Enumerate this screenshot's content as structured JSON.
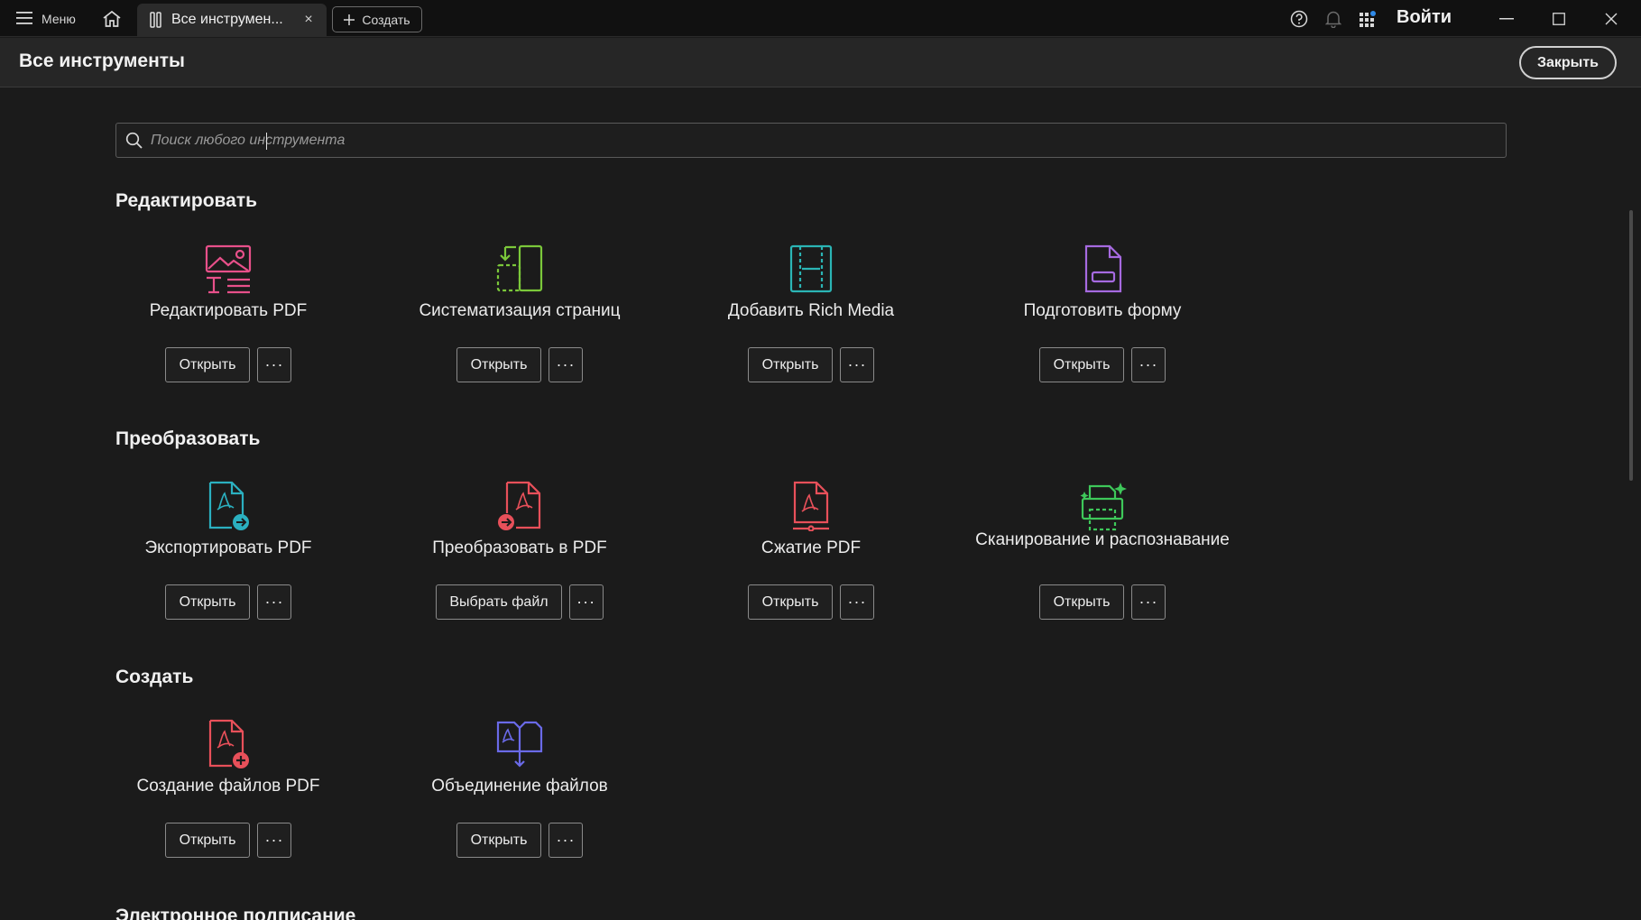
{
  "titlebar": {
    "menu_label": "Меню",
    "tab_label": "Все инструмен...",
    "tab_close": "×",
    "create_label": "Создать",
    "login_label": "Войти"
  },
  "header": {
    "title": "Все инструменты",
    "close_label": "Закрыть"
  },
  "search": {
    "placeholder": "Поиск любого инструмента"
  },
  "sections": [
    {
      "title": "Редактировать",
      "tools": [
        {
          "name": "Редактировать PDF",
          "button": "Открыть",
          "icon": "edit-pdf-icon",
          "color": "#e8508a"
        },
        {
          "name": "Систематизация страниц",
          "button": "Открыть",
          "icon": "organize-pages-icon",
          "color": "#7bc83a"
        },
        {
          "name": "Добавить Rich Media",
          "button": "Открыть",
          "icon": "rich-media-icon",
          "color": "#2bb5b5"
        },
        {
          "name": "Подготовить форму",
          "button": "Открыть",
          "icon": "prepare-form-icon",
          "color": "#a66ae0"
        }
      ]
    },
    {
      "title": "Преобразовать",
      "tools": [
        {
          "name": "Экспортировать PDF",
          "button": "Открыть",
          "icon": "export-pdf-icon",
          "color": "#2bb0c0"
        },
        {
          "name": "Преобразовать в PDF",
          "button": "Выбрать файл",
          "icon": "convert-to-pdf-icon",
          "color": "#e8505a"
        },
        {
          "name": "Сжатие PDF",
          "button": "Открыть",
          "icon": "compress-pdf-icon",
          "color": "#e8505a"
        },
        {
          "name": "Сканирование и распознавание",
          "button": "Открыть",
          "icon": "scan-ocr-icon",
          "color": "#3ec85a"
        }
      ]
    },
    {
      "title": "Создать",
      "tools": [
        {
          "name": "Создание файлов PDF",
          "button": "Открыть",
          "icon": "create-pdf-icon",
          "color": "#e8505a"
        },
        {
          "name": "Объединение файлов",
          "button": "Открыть",
          "icon": "combine-files-icon",
          "color": "#6a6ae8"
        }
      ]
    },
    {
      "title": "Электронное подписание",
      "tools": []
    }
  ],
  "more_label": "···"
}
